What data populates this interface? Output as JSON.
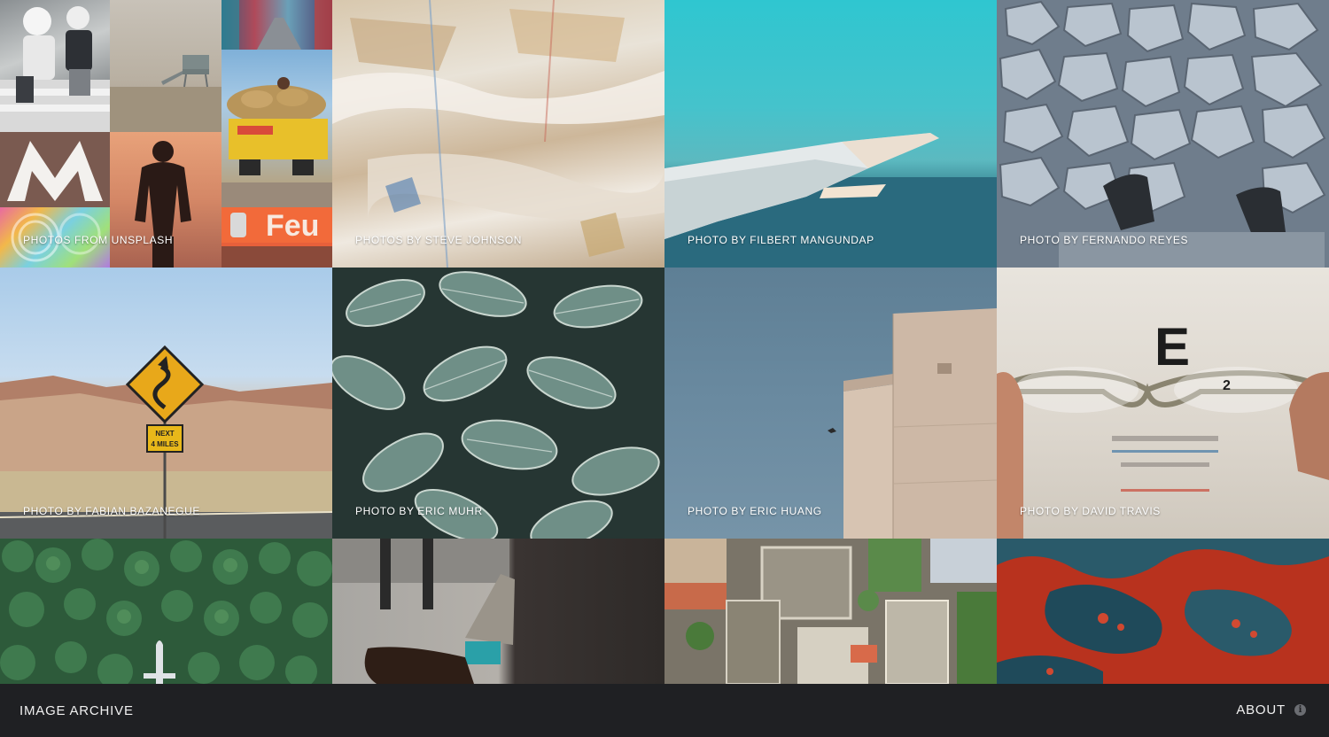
{
  "footer": {
    "brand": "IMAGE ARCHIVE",
    "about_label": "ABOUT",
    "about_icon": "info-icon"
  },
  "collage": {
    "caption": "PHOTOS FROM UNSPLASH",
    "sign_text": "Feu"
  },
  "tiles": [
    {
      "caption": "PHOTOS BY STEVE JOHNSON",
      "subject": "abstract painted texture"
    },
    {
      "caption": "PHOTO BY FILBERT MANGUNDAP",
      "subject": "airplane wing over sea"
    },
    {
      "caption": "PHOTO BY FERNANDO REYES",
      "subject": "feet on gravel rocks"
    },
    {
      "caption": "PHOTO BY FABIAN BAZANEGUE",
      "subject": "winding road sign in desert",
      "sign_text": "NEXT 4 MILES"
    },
    {
      "caption": "PHOTO BY ERIC MUHR",
      "subject": "striped green leaves"
    },
    {
      "caption": "PHOTO BY ERIC HUANG",
      "subject": "building corner against sky"
    },
    {
      "caption": "PHOTO BY DAVID TRAVIS",
      "subject": "eyeglasses and eye chart",
      "chart_letter": "E"
    },
    {
      "caption": "",
      "subject": "aerial pine forest with plane"
    },
    {
      "caption": "",
      "subject": "crossed legs with teal socks"
    },
    {
      "caption": "",
      "subject": "aerial rooftops of city"
    },
    {
      "caption": "",
      "subject": "red and teal fluid art"
    }
  ],
  "colors": {
    "footer_bg": "#1f2023",
    "footer_text": "#f0f0f0",
    "caption_text": "#ffffff"
  }
}
